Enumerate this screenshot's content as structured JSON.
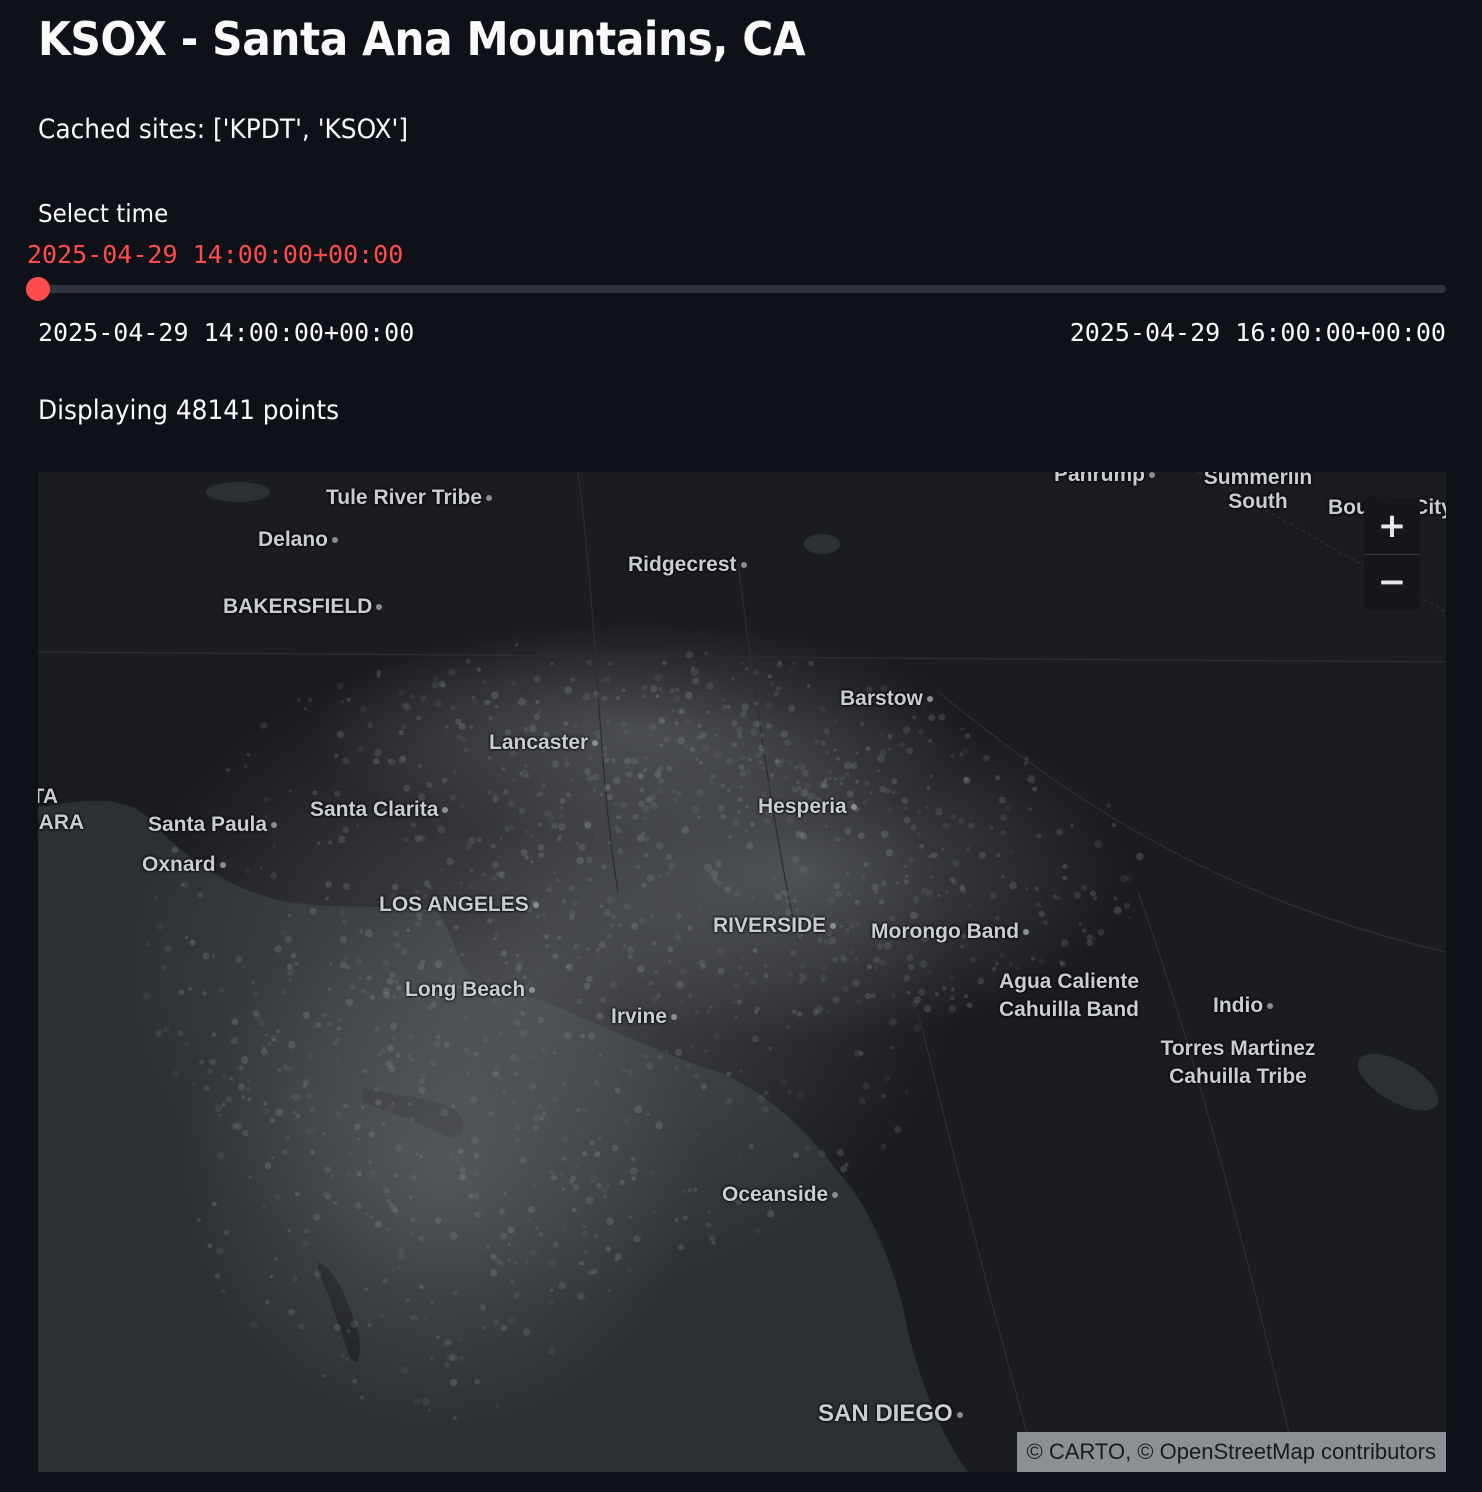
{
  "title": "KSOX - Santa Ana Mountains, CA",
  "cached_sites": "Cached sites: ['KPDT', 'KSOX']",
  "slider": {
    "label": "Select time",
    "value": "2025-04-29 14:00:00+00:00",
    "min": "2025-04-29 14:00:00+00:00",
    "max": "2025-04-29 16:00:00+00:00",
    "position_fraction": 0.0,
    "accent_color": "#ff4b4b"
  },
  "display_count": "Displaying 48141 points",
  "map": {
    "basemap": "dark",
    "cities": [
      {
        "name": "Tule River Tribe"
      },
      {
        "name": "Delano"
      },
      {
        "name": "Ridgecrest"
      },
      {
        "name": "BAKERSFIELD"
      },
      {
        "name": "Pahrump"
      },
      {
        "name": "Summerlin South"
      },
      {
        "name": "Boulder City"
      },
      {
        "name": "Barstow"
      },
      {
        "name": "Lancaster"
      },
      {
        "name": "Santa Clarita"
      },
      {
        "name": "Santa Paula"
      },
      {
        "name": "Hesperia"
      },
      {
        "name": "Oxnard"
      },
      {
        "name": "LOS ANGELES"
      },
      {
        "name": "RIVERSIDE"
      },
      {
        "name": "Morongo Band"
      },
      {
        "name": "Agua Caliente Cahuilla Band"
      },
      {
        "name": "Indio"
      },
      {
        "name": "Long Beach"
      },
      {
        "name": "Irvine"
      },
      {
        "name": "Torres Martinez Cahuilla Tribe"
      },
      {
        "name": "Oceanside"
      },
      {
        "name": "SAN DIEGO"
      },
      {
        "name": "SANTA BARBARA"
      }
    ],
    "zoom_in_label": "+",
    "zoom_out_label": "−",
    "attribution": "© CARTO, © OpenStreetMap contributors"
  }
}
